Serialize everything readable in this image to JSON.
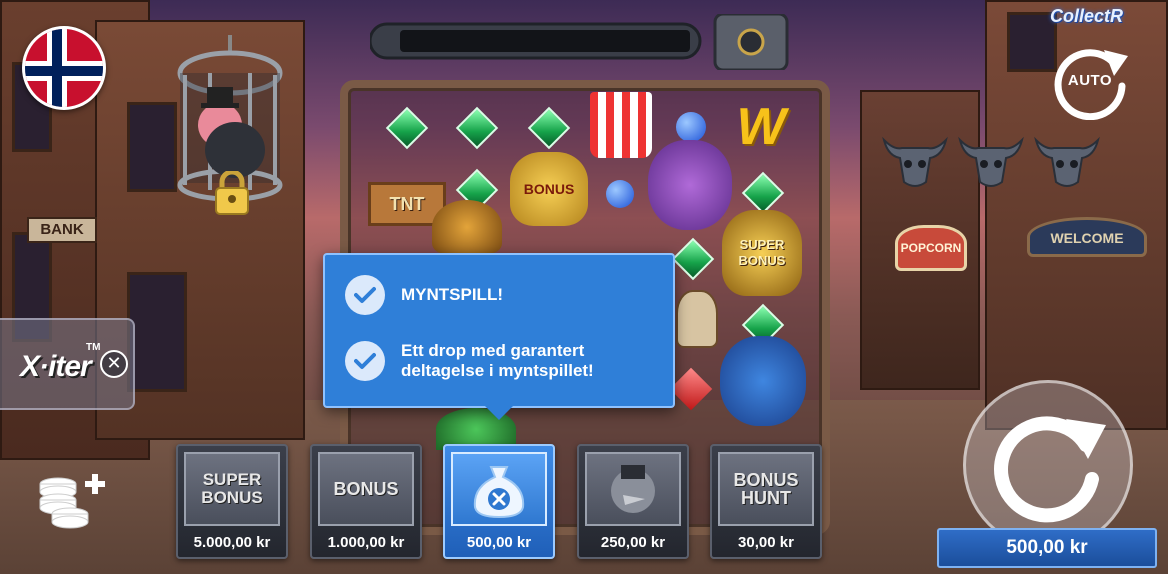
{
  "branding": {
    "collectr": "CollectR"
  },
  "auto_button": {
    "label": "AUTO"
  },
  "xiter": {
    "label": "X·iter",
    "tm": "TM",
    "close": "✕"
  },
  "tooltip": {
    "items": [
      {
        "text": "MYNTSPILL!"
      },
      {
        "text": "Ett drop med garantert deltagelse i myntspillet!"
      }
    ]
  },
  "feature_cards": [
    {
      "art_label": "SUPER BONUS",
      "price": "5.000,00 kr",
      "active": false
    },
    {
      "art_label": "BONUS",
      "price": "1.000,00 kr",
      "active": false
    },
    {
      "art_label": "",
      "price": "500,00 kr",
      "active": true
    },
    {
      "art_label": "",
      "price": "250,00 kr",
      "active": false
    },
    {
      "art_label": "BONUS HUNT",
      "price": "30,00 kr",
      "active": false
    }
  ],
  "bet": {
    "amount": "500,00 kr"
  },
  "reel_symbols": {
    "tnt": "TNT",
    "bonus": "BONUS",
    "super_bonus": "SUPER BONUS",
    "wild": "W",
    "popcorn_sign": "POPCORN",
    "welcome_sign": "WELCOME",
    "bank_sign": "BANK"
  },
  "colors": {
    "accent": "#2f7fd8",
    "bet_bar": "#1b4e9b",
    "flag_red": "#c8102e",
    "flag_blue": "#00205b"
  },
  "icons": [
    "norway-flag-icon",
    "check-icon",
    "close-icon",
    "coins-add-icon",
    "spin-arrow-icon",
    "auto-arrow-icon",
    "padlock-icon",
    "bull-skull-icon"
  ]
}
